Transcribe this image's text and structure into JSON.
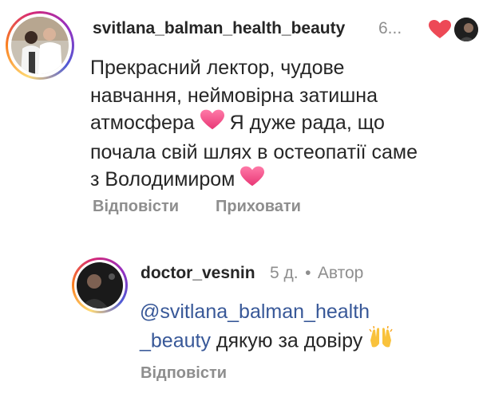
{
  "comment": {
    "username": "svitlana_balman_health_beauty",
    "time_truncated": "6...",
    "text_lines": [
      "Прекрасний лектор, чудове",
      "навчання, неймовірна затишна",
      "атмосфера",
      "Я дуже рада, що",
      "почала свій шлях в остеопатії саме",
      "з Володимиром"
    ],
    "actions": {
      "reply": "Відповісти",
      "hide": "Приховати"
    },
    "like_color": "#ed4956"
  },
  "reply": {
    "username": "doctor_vesnin",
    "time": "5 д.",
    "separator": "•",
    "author_label": "Автор",
    "mention_line1": "@svitlana_balman_health",
    "mention_line2": "_beauty",
    "text": "дякую за довіру",
    "actions": {
      "reply": "Відповісти"
    }
  },
  "icons": {
    "heart": "heart-emoji",
    "raised_hands": "raising-hands-emoji"
  }
}
